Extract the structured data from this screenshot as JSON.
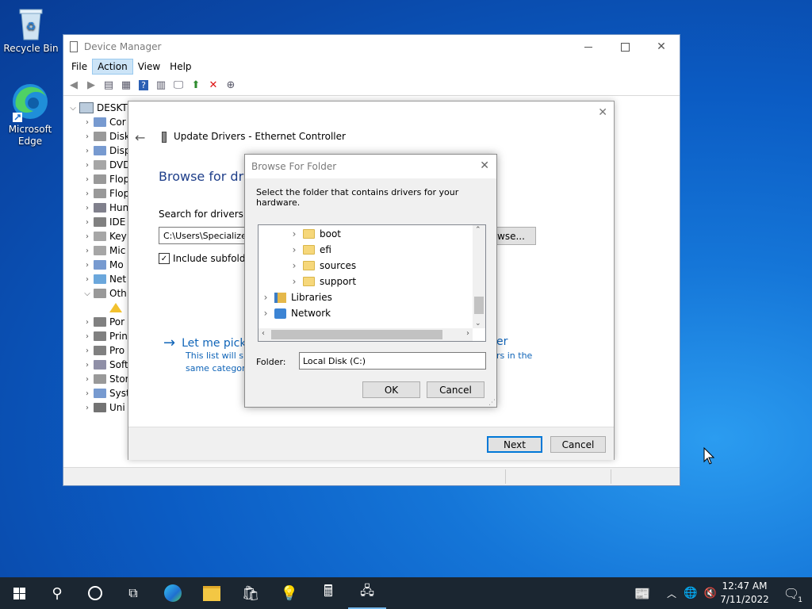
{
  "desktop": {
    "icons": [
      {
        "label": "Recycle Bin",
        "icon": "recycle-bin-icon"
      },
      {
        "label": "Microsoft Edge",
        "icon": "edge-icon"
      }
    ]
  },
  "device_manager": {
    "title": "Device Manager",
    "menu": [
      "File",
      "Action",
      "View",
      "Help"
    ],
    "active_menu": "Action",
    "tree_root": "DESKTO",
    "tree_items": [
      "Cor",
      "Disk",
      "Disp",
      "DVD",
      "Flop",
      "Flop",
      "Hun",
      "IDE",
      "Key",
      "Mic",
      "Mo",
      "Net",
      "Oth",
      "",
      "Por",
      "Prin",
      "Pro",
      "Soft",
      "Stor",
      "Syst",
      "Uni"
    ]
  },
  "update_drivers": {
    "title": "Update Drivers - Ethernet Controller",
    "heading": "Browse for drive",
    "search_label": "Search for drivers in t",
    "path_value": "C:\\Users\\Specialize",
    "browse_label": "wse...",
    "include_subfolders": "Include subfolder",
    "pick_link": "Let me pick",
    "pick_link_tail": "er",
    "pick_desc_line1": "This list will sh",
    "pick_desc_line1_tail": "rs in the",
    "pick_desc_line2": "same category",
    "next": "Next",
    "cancel": "Cancel"
  },
  "browse_folder": {
    "title": "Browse For Folder",
    "instruction": "Select the folder that contains drivers for your hardware.",
    "tree": [
      {
        "label": "boot",
        "indent": 2
      },
      {
        "label": "efi",
        "indent": 2
      },
      {
        "label": "sources",
        "indent": 2
      },
      {
        "label": "support",
        "indent": 2
      },
      {
        "label": "Libraries",
        "indent": 0
      },
      {
        "label": "Network",
        "indent": 0
      }
    ],
    "folder_label": "Folder:",
    "folder_value": "Local Disk (C:)",
    "ok": "OK",
    "cancel": "Cancel"
  },
  "taskbar": {
    "time": "12:47 AM",
    "date": "7/11/2022",
    "notification_count": "1"
  }
}
